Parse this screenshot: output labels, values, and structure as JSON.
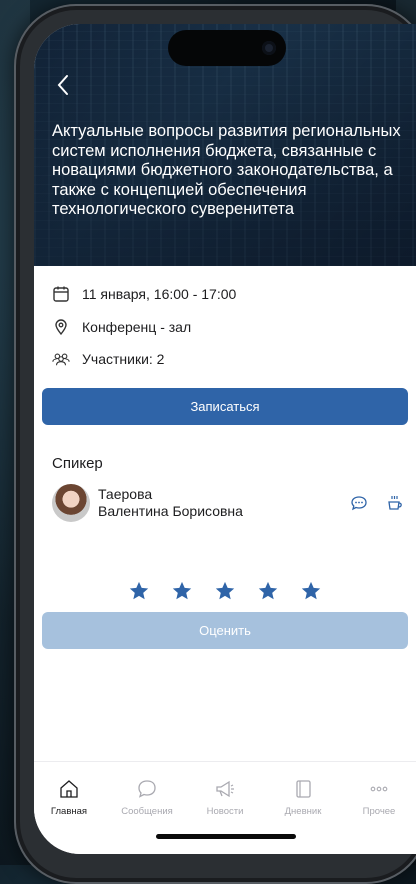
{
  "header": {
    "back_icon": "chevron-left-icon",
    "title": "Актуальные вопросы развития региональных систем исполнения бюджета, связанные с новациями бюджетного законодательства, а также с концепцией обеспечения технологического суверенитета"
  },
  "event": {
    "datetime": "11 января, 16:00 - 17:00",
    "location": "Конференц - зал",
    "participants": "Участники: 2"
  },
  "register_button": {
    "label": "Записаться"
  },
  "speaker_section": {
    "title": "Спикер",
    "speaker": {
      "name_line1": "Таерова",
      "name_line2": "Валентина Борисовна"
    }
  },
  "rating": {
    "stars": 5,
    "star_color": "#2f64a8"
  },
  "rate_button": {
    "label": "Оценить"
  },
  "tabbar": {
    "items": [
      {
        "label": "Главная",
        "icon": "home-icon",
        "active": true
      },
      {
        "label": "Сообщения",
        "icon": "chat-icon",
        "active": false
      },
      {
        "label": "Новости",
        "icon": "megaphone-icon",
        "active": false
      },
      {
        "label": "Дневник",
        "icon": "notebook-icon",
        "active": false
      },
      {
        "label": "Прочее",
        "icon": "more-icon",
        "active": false
      }
    ]
  },
  "colors": {
    "accent": "#2f64a8",
    "accent_disabled": "#a6c1dd"
  }
}
